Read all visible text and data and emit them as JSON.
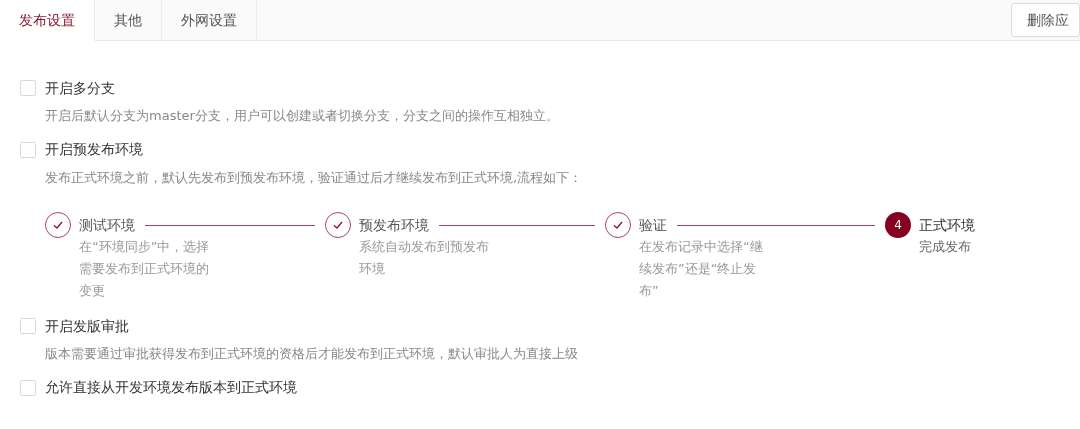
{
  "tabs": [
    {
      "label": "发布设置",
      "selected": true
    },
    {
      "label": "其他",
      "selected": false
    },
    {
      "label": "外网设置",
      "selected": false
    }
  ],
  "delete_button": "删除应",
  "options": [
    {
      "label": "开启多分支",
      "checked": false,
      "description": "开启后默认分支为master分支，用户可以创建或者切换分支，分支之间的操作互相独立。"
    },
    {
      "label": "开启预发布环境",
      "checked": false,
      "description": "发布正式环境之前，默认先发布到预发布环境，验证通过后才继续发布到正式环境,流程如下：",
      "steps": [
        {
          "kind": "done",
          "title": "测试环境",
          "description": "在“环境同步”中，选择需要发布到正式环境的变更"
        },
        {
          "kind": "done",
          "title": "预发布环境",
          "description": "系统自动发布到预发布环境"
        },
        {
          "kind": "done",
          "title": "验证",
          "description": "在发布记录中选择“继续发布”还是“终止发布”"
        },
        {
          "kind": "current",
          "number": "4",
          "title": "正式环境",
          "description": "完成发布"
        }
      ]
    },
    {
      "label": "开启发版审批",
      "checked": false,
      "description": "版本需要通过审批获得发布到正式环境的资格后才能发布到正式环境，默认审批人为直接上级"
    },
    {
      "label": "允许直接从开发环境发布版本到正式环境",
      "checked": false
    }
  ]
}
